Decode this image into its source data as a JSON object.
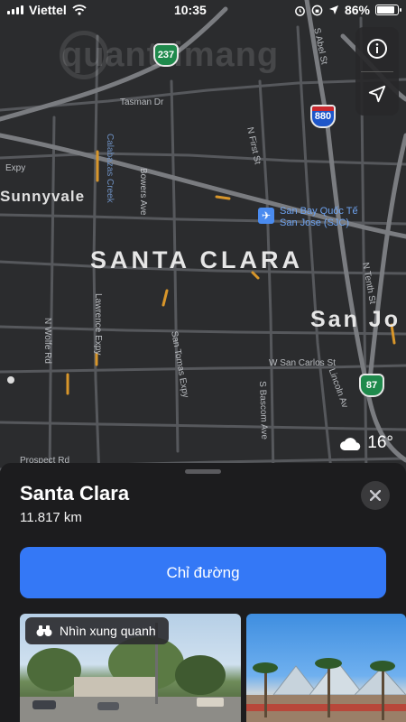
{
  "status_bar": {
    "carrier": "Viettel",
    "time": "10:35",
    "battery": "86%",
    "battery_level": 0.86
  },
  "watermark": "quantrimang",
  "map": {
    "city_label": "SANTA CLARA",
    "san_jose_label": "San Jo",
    "sunnyvale_label": "Sunnyvale",
    "airport": {
      "line1": "San Bay Quốc Tế",
      "line2": "San Jose (SJC)"
    },
    "shields": {
      "hwy_237": "237",
      "i_880": "880",
      "hwy_87": "87"
    },
    "streets": {
      "tasman": "Tasman Dr",
      "n_first": "N First St",
      "s_abel": "S Abel St",
      "calabazas": "Calabazas Creek",
      "bowers": "Bowers Ave",
      "n_wolfe": "N Wolfe Rd",
      "lawrence": "Lawrence Expy",
      "san_tomas": "San Tomas Expy",
      "w_san_carlos": "W San Carlos St",
      "s_bascom": "S Bascom Ave",
      "lincoln": "Lincoln Av",
      "n_tenth": "N Tenth St",
      "prospect": "Prospect Rd",
      "expy": "Expy"
    },
    "weather": {
      "temp": "16°",
      "icon": "cloud-icon"
    },
    "controls": {
      "info_icon": "info-icon",
      "location_icon": "location-arrow-icon"
    }
  },
  "sheet": {
    "title": "Santa Clara",
    "distance": "11.817 km",
    "directions_label": "Chỉ đường",
    "lookaround_label": "Nhìn xung quanh"
  },
  "colors": {
    "accent": "#3478f6",
    "sheet_bg": "#1c1c1e",
    "map_bg": "#2b2c2e",
    "airport_text": "#6ea3f0"
  }
}
